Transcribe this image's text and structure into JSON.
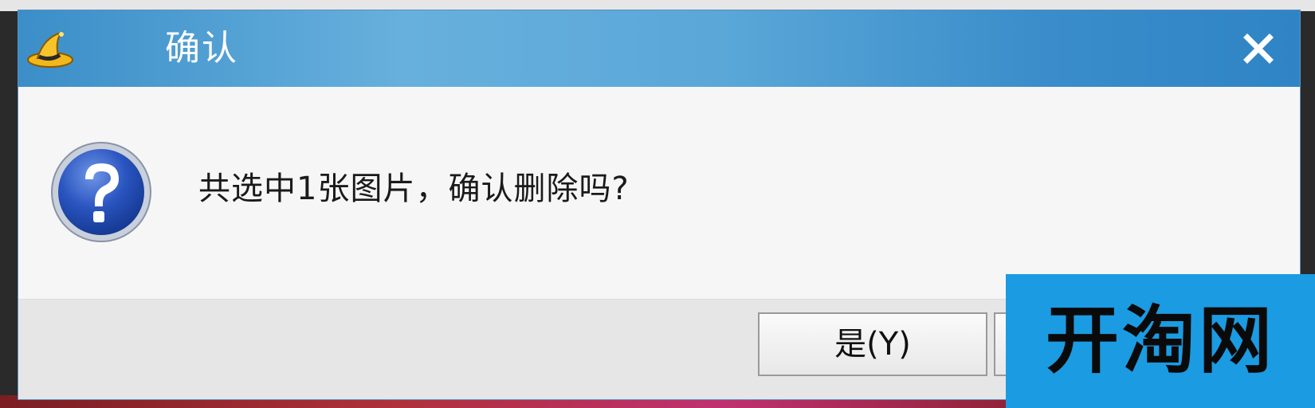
{
  "dialog": {
    "title": "确认",
    "app_icon": "wizard-hat-icon",
    "close_icon": "close-icon",
    "message_icon": "question-icon",
    "message": "共选中1张图片，确认删除吗?",
    "buttons": {
      "yes_label": "是(Y)",
      "no_label": ""
    }
  },
  "watermark": {
    "text": "开淘网"
  },
  "colors": {
    "titlebar": "#5aa7d8",
    "watermark_bg": "#1b9be2",
    "dialog_bg": "#f6f6f6",
    "button_bar_bg": "#e6e6e6"
  }
}
